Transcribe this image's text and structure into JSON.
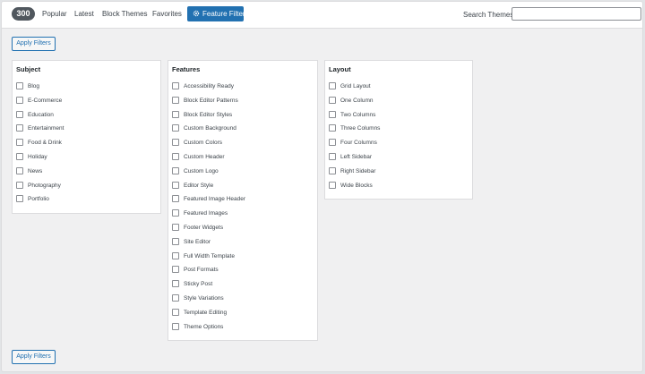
{
  "topbar": {
    "count": "300",
    "tabs": [
      "Popular",
      "Latest",
      "Block Themes",
      "Favorites"
    ],
    "feature_filter_label": "Feature Filter",
    "search_label": "Search Themes",
    "search_value": ""
  },
  "actions": {
    "apply_top": "Apply Filters",
    "apply_bottom": "Apply Filters"
  },
  "filters": {
    "subject": {
      "title": "Subject",
      "options": [
        "Blog",
        "E-Commerce",
        "Education",
        "Entertainment",
        "Food & Drink",
        "Holiday",
        "News",
        "Photography",
        "Portfolio"
      ]
    },
    "features": {
      "title": "Features",
      "options": [
        "Accessibility Ready",
        "Block Editor Patterns",
        "Block Editor Styles",
        "Custom Background",
        "Custom Colors",
        "Custom Header",
        "Custom Logo",
        "Editor Style",
        "Featured Image Header",
        "Featured Images",
        "Footer Widgets",
        "Site Editor",
        "Full Width Template",
        "Post Formats",
        "Sticky Post",
        "Style Variations",
        "Template Editing",
        "Theme Options"
      ]
    },
    "layout": {
      "title": "Layout",
      "options": [
        "Grid Layout",
        "One Column",
        "Two Columns",
        "Three Columns",
        "Four Columns",
        "Left Sidebar",
        "Right Sidebar",
        "Wide Blocks"
      ]
    }
  }
}
